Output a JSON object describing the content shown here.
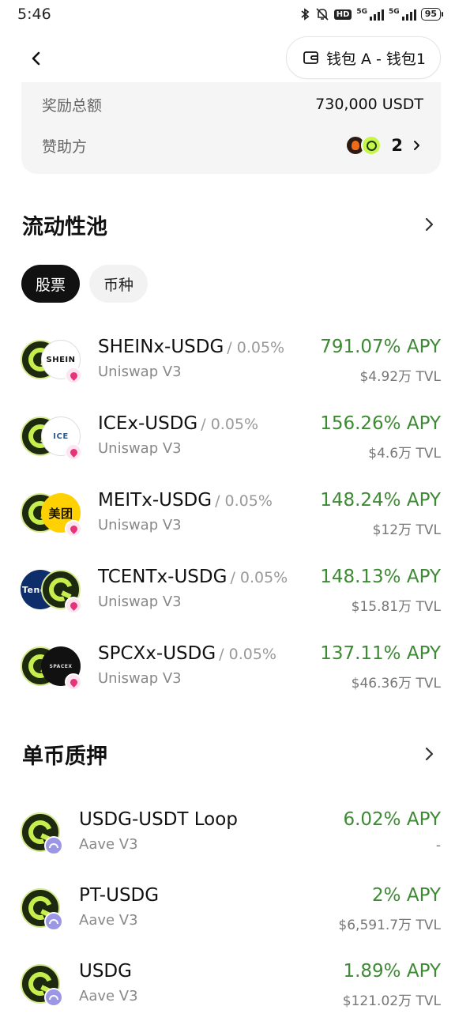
{
  "status": {
    "time": "5:46",
    "battery": "95",
    "hd": "HD",
    "net1": "5G",
    "net2": "5G"
  },
  "header": {
    "wallet_label": "钱包 A - 钱包1"
  },
  "info": {
    "reward_label": "奖励总额",
    "reward_value": "730,000 USDT",
    "sponsor_label": "赞助方",
    "sponsor_count": "2"
  },
  "liquidity": {
    "title": "流动性池",
    "tabs": [
      "股票",
      "币种"
    ],
    "pools": [
      {
        "name": "SHEINx-USDG",
        "fee": "/ 0.05%",
        "protocol": "Uniswap V3",
        "apy": "791.07% APY",
        "tvl": "$4.92万 TVL",
        "logo_text": "SHEIN"
      },
      {
        "name": "ICEx-USDG",
        "fee": "/ 0.05%",
        "protocol": "Uniswap V3",
        "apy": "156.26% APY",
        "tvl": "$4.6万 TVL",
        "logo_text": "ICE"
      },
      {
        "name": "MEITx-USDG",
        "fee": "/ 0.05%",
        "protocol": "Uniswap V3",
        "apy": "148.24% APY",
        "tvl": "$12万 TVL",
        "logo_text": "美团"
      },
      {
        "name": "TCENTx-USDG",
        "fee": "/ 0.05%",
        "protocol": "Uniswap V3",
        "apy": "148.13% APY",
        "tvl": "$15.81万 TVL",
        "logo_text": "Tenc"
      },
      {
        "name": "SPCXx-USDG",
        "fee": "/ 0.05%",
        "protocol": "Uniswap V3",
        "apy": "137.11% APY",
        "tvl": "$46.36万 TVL",
        "logo_text": "SPACEX"
      }
    ]
  },
  "staking": {
    "title": "单币质押",
    "items": [
      {
        "name": "USDG-USDT Loop",
        "protocol": "Aave V3",
        "apy": "6.02% APY",
        "tvl": "-"
      },
      {
        "name": "PT-USDG",
        "protocol": "Aave V3",
        "apy": "2% APY",
        "tvl": "$6,591.7万 TVL"
      },
      {
        "name": "USDG",
        "protocol": "Aave V3",
        "apy": "1.89% APY",
        "tvl": "$121.02万 TVL"
      }
    ]
  },
  "colors": {
    "apy_green": "#3d8a34",
    "usdg_lime": "#c6ef4e",
    "card_bg": "#f5f5f5"
  },
  "icons": {
    "back": "chevron-left-icon",
    "wallet": "wallet-icon",
    "more": "chevron-right-icon"
  }
}
